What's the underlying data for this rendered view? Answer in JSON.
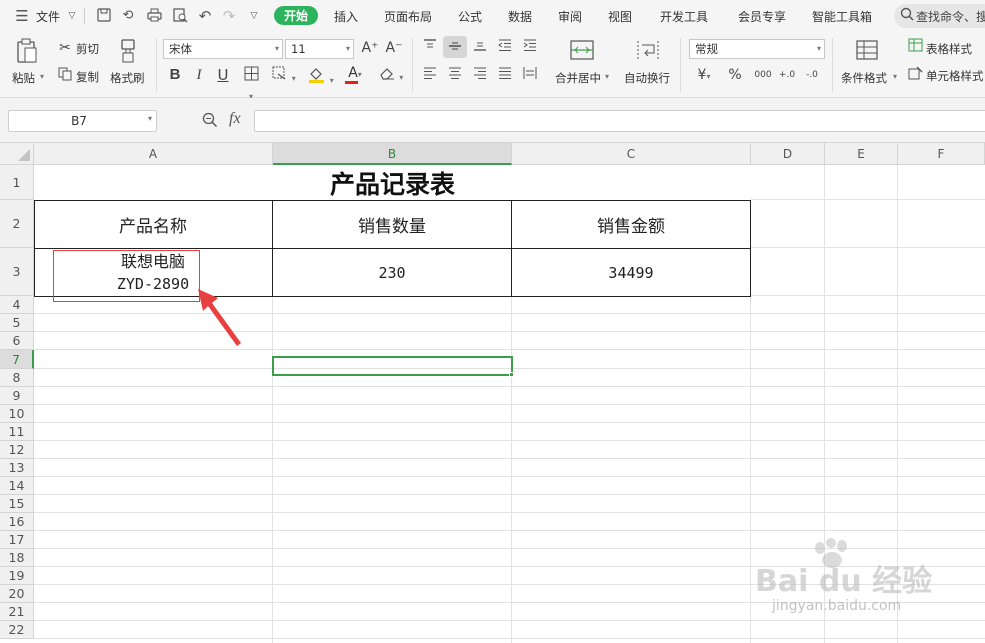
{
  "menu": {
    "file_label": "文件",
    "tabs": [
      "开始",
      "插入",
      "页面布局",
      "公式",
      "数据",
      "审阅",
      "视图",
      "开发工具",
      "会员专享",
      "智能工具箱"
    ],
    "search_placeholder": "查找命令、搜"
  },
  "ribbon": {
    "paste": "粘贴",
    "cut": "剪切",
    "copy": "复制",
    "format_painter": "格式刷",
    "font_name": "宋体",
    "font_size": "11",
    "merge_center": "合并居中",
    "wrap_text": "自动换行",
    "number_format": "常规",
    "conditional_format": "条件格式",
    "table_style": "表格样式",
    "cell_style": "单元格样式",
    "bold": "B",
    "italic": "I",
    "underline": "U",
    "grow_font": "A⁺",
    "shrink_font": "A⁻",
    "font_color_letter": "A",
    "currency": "¥",
    "percent": "%",
    "thousands": "000",
    "inc_decimal": "+.0",
    "dec_decimal": "-.0"
  },
  "formula_bar": {
    "name_box": "B7",
    "fx": "fx",
    "content": ""
  },
  "columns": [
    "A",
    "B",
    "C",
    "D",
    "E",
    "F"
  ],
  "rows": [
    "1",
    "2",
    "3",
    "4",
    "5",
    "6",
    "7",
    "8",
    "9",
    "10",
    "11",
    "12",
    "13",
    "14",
    "15",
    "16",
    "17",
    "18",
    "19",
    "20",
    "21",
    "22"
  ],
  "table": {
    "title": "产品记录表",
    "headers": [
      "产品名称",
      "销售数量",
      "销售金额"
    ],
    "row3": {
      "product_line1": "联想电脑",
      "product_line2": "ZYD-2890",
      "quantity": "230",
      "amount": "34499"
    }
  },
  "watermark": {
    "brand": "Bai du 经验",
    "url": "jingyan.baidu.com"
  },
  "colors": {
    "accent_green": "#2db35d",
    "selection_green": "#3b9e4a",
    "annotation_red": "#e84040"
  }
}
